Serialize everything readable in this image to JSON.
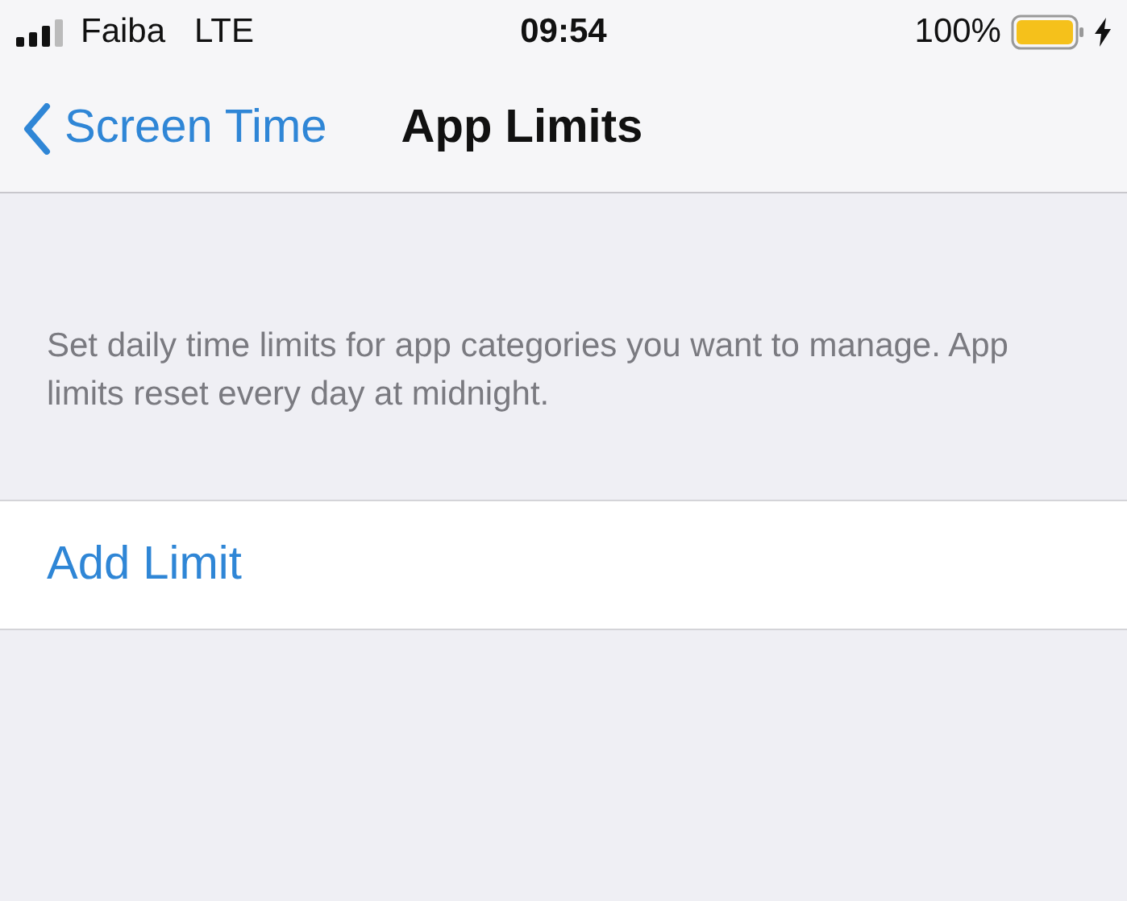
{
  "status_bar": {
    "carrier": "Faiba",
    "network": "LTE",
    "time": "09:54",
    "battery": "100%"
  },
  "nav": {
    "back": "Screen Time",
    "title": "App Limits"
  },
  "description": "Set daily time limits for app categories you want to manage. App limits reset every day at midnight.",
  "actions": [
    "Add Limit"
  ]
}
